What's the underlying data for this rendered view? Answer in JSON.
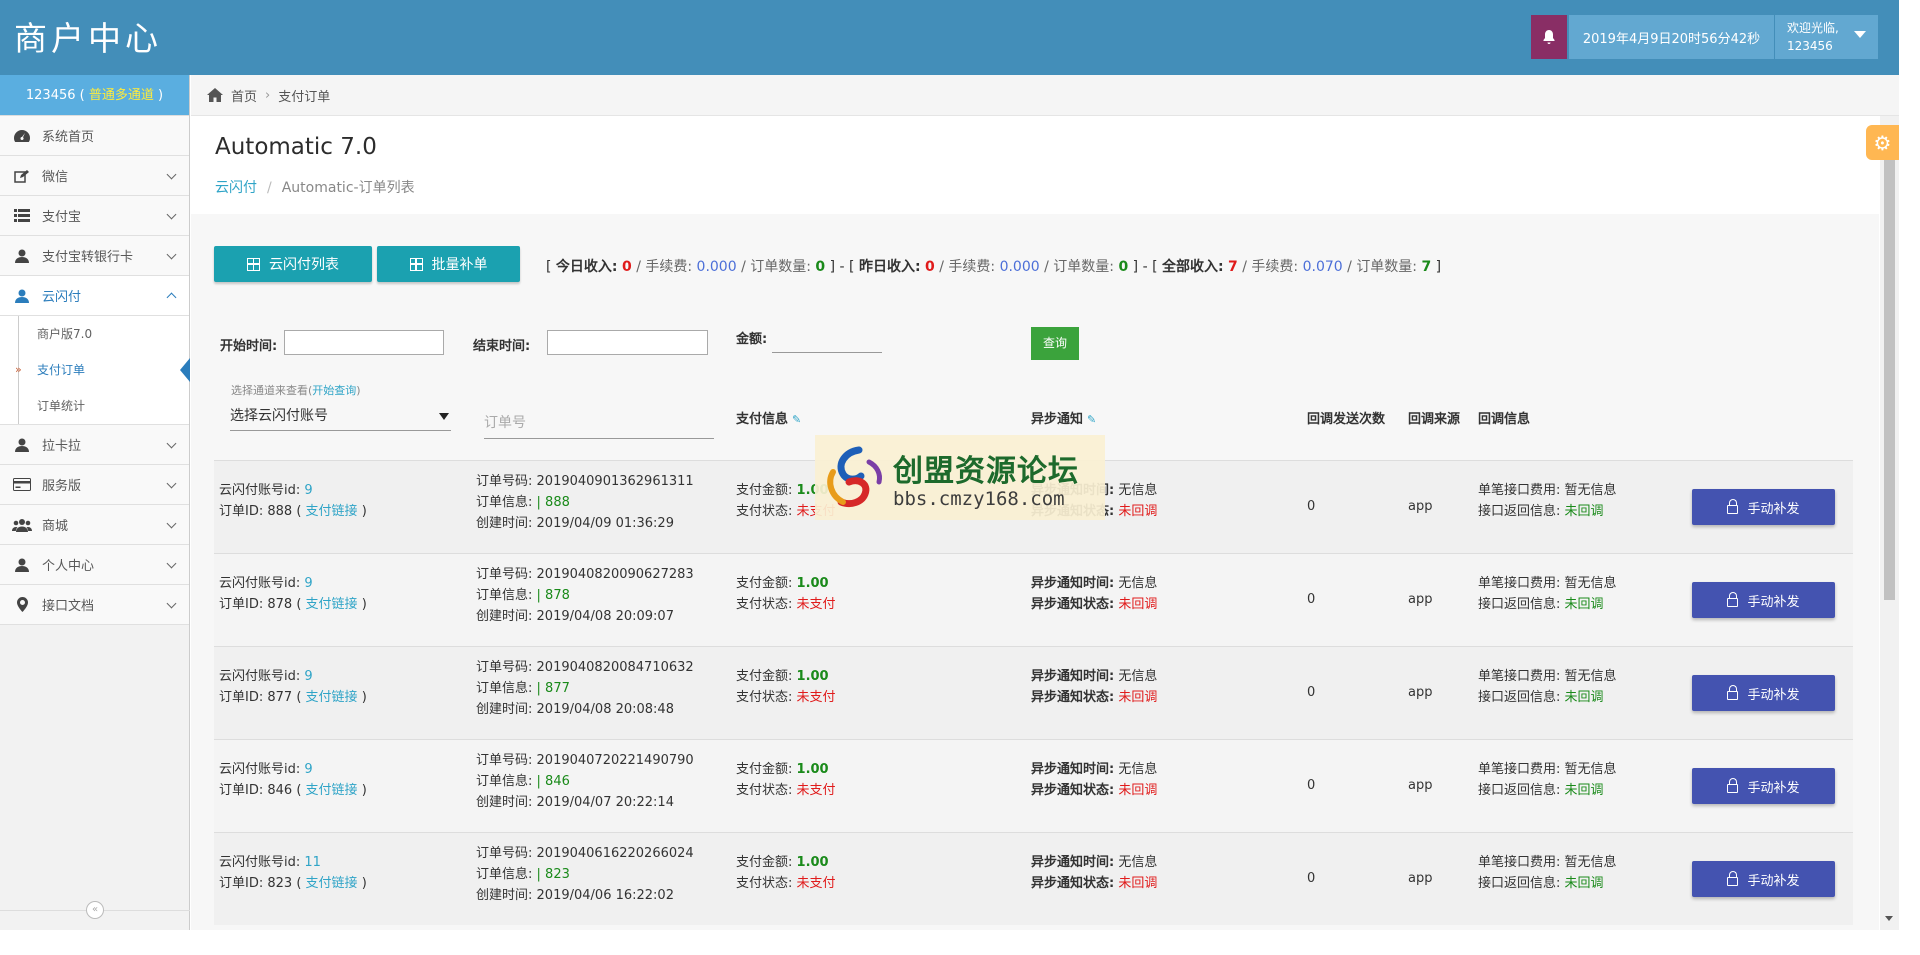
{
  "header": {
    "brand": "商户中心",
    "datetime": "2019年4月9日20时56分42秒",
    "welcome": "欢迎光临,",
    "username": "123456"
  },
  "sidebar": {
    "user_id": "123456",
    "user_level": "普通多通道",
    "items": [
      {
        "label": "系统首页",
        "icon": "dashboard-icon"
      },
      {
        "label": "微信",
        "icon": "edit-icon"
      },
      {
        "label": "支付宝",
        "icon": "list-icon"
      },
      {
        "label": "支付宝转银行卡",
        "icon": "user-icon"
      },
      {
        "label": "云闪付",
        "icon": "user-icon"
      },
      {
        "label": "拉卡拉",
        "icon": "user-icon"
      },
      {
        "label": "服务版",
        "icon": "credit-card-icon"
      },
      {
        "label": "商城",
        "icon": "users-icon"
      },
      {
        "label": "个人中心",
        "icon": "user-icon"
      },
      {
        "label": "接口文档",
        "icon": "map-marker-icon"
      }
    ],
    "subitems": [
      "商户版7.0",
      "支付订单",
      "订单统计"
    ]
  },
  "breadcrumb": {
    "home": "首页",
    "current": "支付订单"
  },
  "page": {
    "title": "Automatic 7.0",
    "sub_link": "云闪付",
    "sub_current": "Automatic-订单列表"
  },
  "toolbar": {
    "btn_list": "云闪付列表",
    "btn_batch": "批量补单"
  },
  "stats": {
    "today_label": "今日收入:",
    "today_income": "0",
    "fee_label": "手续费:",
    "today_fee": "0.000",
    "count_label": "订单数量:",
    "today_count": "0",
    "yesterday_label": "昨日收入:",
    "yesterday_income": "0",
    "yesterday_fee": "0.000",
    "yesterday_count": "0",
    "all_label": "全部收入:",
    "all_income": "7",
    "all_fee": "0.070",
    "all_count": "7"
  },
  "filters": {
    "start_label": "开始时间:",
    "end_label": "结束时间:",
    "amount_label": "金额:",
    "query_btn": "查询",
    "hint_text": "选择通道来查看(",
    "hint_link": "开始查询",
    "hint_close": ")",
    "select_value": "选择云闪付账号",
    "orderno_placeholder": "订单号"
  },
  "columns": {
    "pay_info": "支付信息",
    "async_notify": "异步通知",
    "callback_count": "回调发送次数",
    "callback_source": "回调来源",
    "callback_info": "回调信息"
  },
  "labels": {
    "account_id": "云闪付账号id:",
    "order_id": "订单ID:",
    "pay_link": "支付链接",
    "order_no": "订单号码:",
    "order_info": "订单信息:",
    "created": "创建时间:",
    "pay_amount": "支付金额:",
    "pay_status": "支付状态:",
    "notify_time": "异步通知时间:",
    "notify_status": "异步通知状态:",
    "fee_single": "单笔接口费用:",
    "return_info": "接口返回信息:",
    "manual_fix": "手动补发"
  },
  "orders": [
    {
      "account_id": "9",
      "order_id": "888",
      "order_no": "2019040901362961311",
      "order_info": "| 888",
      "created": "2019/04/09 01:36:29",
      "amount": "1.00",
      "status": "未支付",
      "notify_time": "无信息",
      "notify_status": "未回调",
      "callbacks": "0",
      "source": "app",
      "fee": "暂无信息",
      "return_info": "未回调"
    },
    {
      "account_id": "9",
      "order_id": "878",
      "order_no": "2019040820090627283",
      "order_info": "| 878",
      "created": "2019/04/08 20:09:07",
      "amount": "1.00",
      "status": "未支付",
      "notify_time": "无信息",
      "notify_status": "未回调",
      "callbacks": "0",
      "source": "app",
      "fee": "暂无信息",
      "return_info": "未回调"
    },
    {
      "account_id": "9",
      "order_id": "877",
      "order_no": "2019040820084710632",
      "order_info": "| 877",
      "created": "2019/04/08 20:08:48",
      "amount": "1.00",
      "status": "未支付",
      "notify_time": "无信息",
      "notify_status": "未回调",
      "callbacks": "0",
      "source": "app",
      "fee": "暂无信息",
      "return_info": "未回调"
    },
    {
      "account_id": "9",
      "order_id": "846",
      "order_no": "2019040720221490790",
      "order_info": "| 846",
      "created": "2019/04/07 20:22:14",
      "amount": "1.00",
      "status": "未支付",
      "notify_time": "无信息",
      "notify_status": "未回调",
      "callbacks": "0",
      "source": "app",
      "fee": "暂无信息",
      "return_info": "未回调"
    },
    {
      "account_id": "11",
      "order_id": "823",
      "order_no": "2019040616220266024",
      "order_info": "| 823",
      "created": "2019/04/06 16:22:02",
      "amount": "1.00",
      "status": "未支付",
      "notify_time": "无信息",
      "notify_status": "未回调",
      "callbacks": "0",
      "source": "app",
      "fee": "暂无信息",
      "return_info": "未回调"
    }
  ],
  "watermark": {
    "text": "创盟资源论坛",
    "url": "bbs.cmzy168.com"
  },
  "colors": {
    "header_bg": "#438eb9",
    "bell_bg": "#892e65",
    "teal_button": "#1ba1b0",
    "fix_button": "#4453b0",
    "query_button": "#3ba33c"
  }
}
